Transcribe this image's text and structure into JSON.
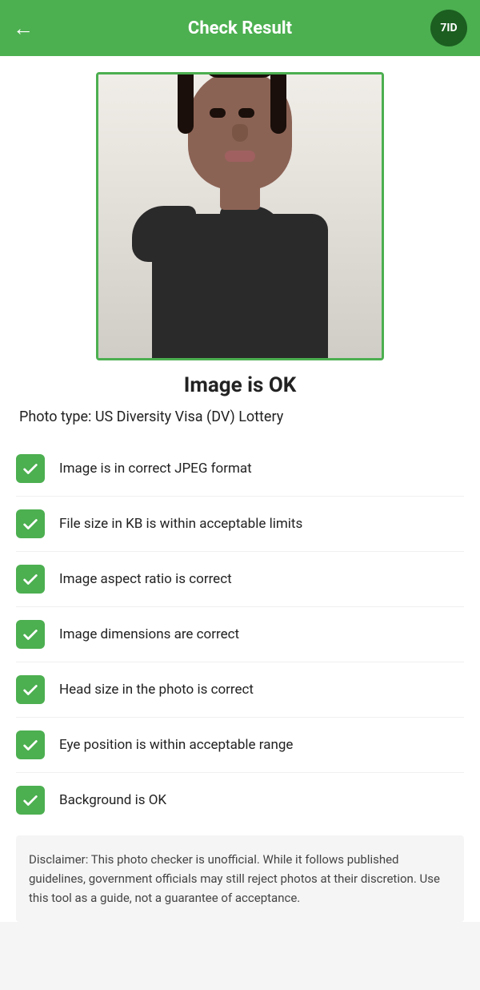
{
  "header": {
    "title": "Check Result",
    "back_label": "←",
    "logo_text": "7ID"
  },
  "status": {
    "title": "Image is OK"
  },
  "photo_type": {
    "label": "Photo type: US Diversity Visa (DV) Lottery"
  },
  "check_items": [
    {
      "id": "jpeg",
      "text": "Image is in correct JPEG format",
      "passed": true
    },
    {
      "id": "filesize",
      "text": "File size in KB is within acceptable limits",
      "passed": true
    },
    {
      "id": "aspect",
      "text": "Image aspect ratio is correct",
      "passed": true
    },
    {
      "id": "dimensions",
      "text": "Image dimensions are correct",
      "passed": true
    },
    {
      "id": "headsize",
      "text": "Head size in the photo is correct",
      "passed": true
    },
    {
      "id": "eyepos",
      "text": "Eye position is within acceptable range",
      "passed": true
    },
    {
      "id": "background",
      "text": "Background is OK",
      "passed": true
    }
  ],
  "disclaimer": {
    "text": "Disclaimer: This photo checker is unofficial. While it follows published guidelines, government officials may still reject photos at their discretion. Use this tool as a guide, not a guarantee of acceptance."
  },
  "colors": {
    "green": "#4caf50",
    "dark_green": "#1b5e20"
  }
}
